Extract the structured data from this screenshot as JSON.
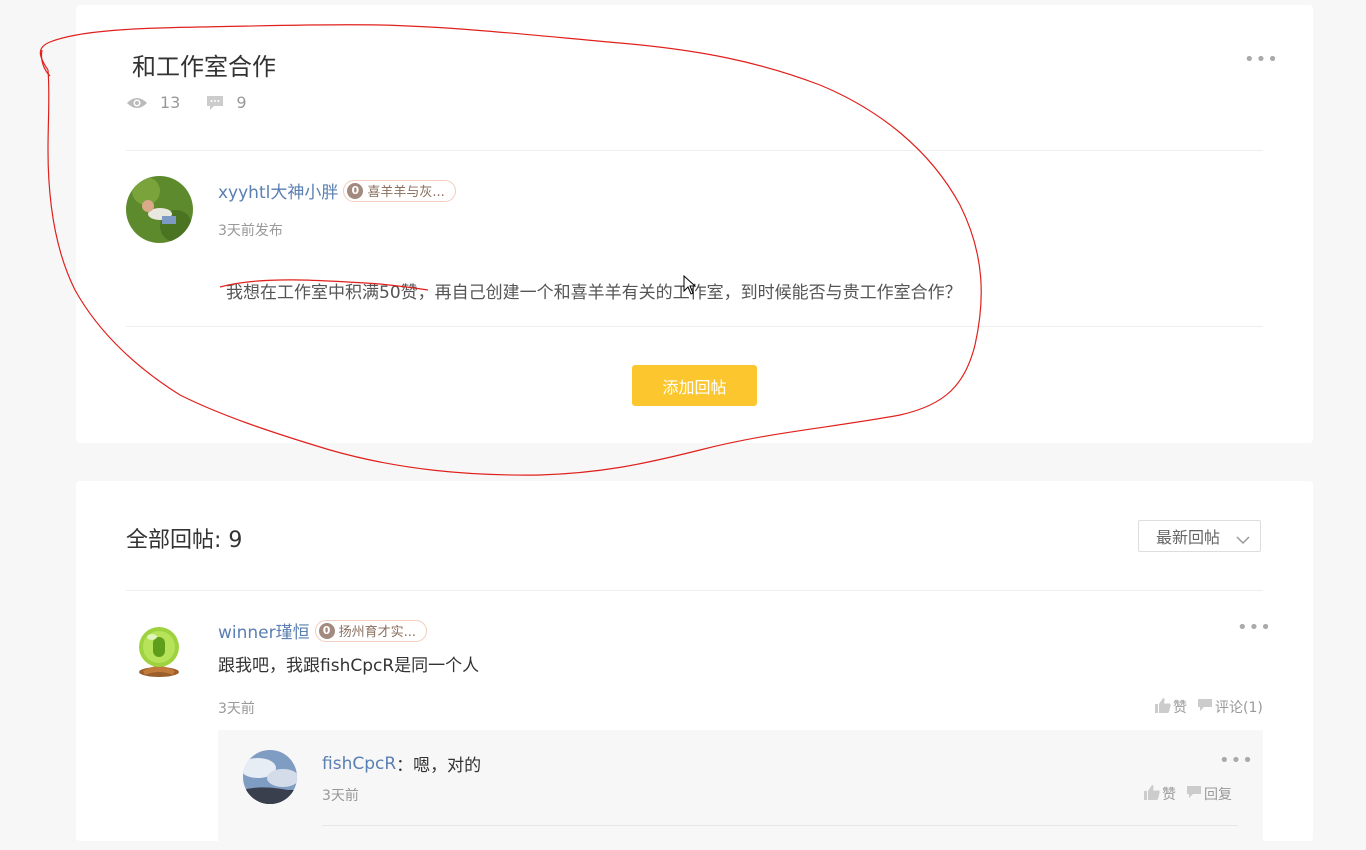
{
  "post": {
    "title": "和工作室合作",
    "views": "13",
    "comments": "9",
    "author": {
      "name": "xyyhtl大神小胖",
      "badge_num": "0",
      "badge_text": "喜羊羊与灰..."
    },
    "time": "3天前发布",
    "body": "我想在工作室中积满50赞，再自己创建一个和喜羊羊有关的工作室，到时候能否与贵工作室合作？",
    "add_reply_label": "添加回帖"
  },
  "replies": {
    "header": "全部回帖: 9",
    "sort_label": "最新回帖",
    "items": [
      {
        "author": "winner瑾恒",
        "badge_num": "0",
        "badge_text": "扬州育才实...",
        "text": "跟我吧，我跟fishCpcR是同一个人",
        "time": "3天前",
        "like_label": "赞",
        "comment_label": "评论(1)",
        "sub_replies": [
          {
            "author": "fishCpcR",
            "text": "：嗯，对的",
            "time": "3天前",
            "like_label": "赞",
            "reply_label": "回复"
          }
        ]
      }
    ]
  },
  "icons": {
    "more": "more-icon",
    "eye": "eye-icon",
    "comment": "comment-icon",
    "thumb": "thumbs-up-icon",
    "chevron": "chevron-down-icon"
  },
  "colors": {
    "accent": "#fcc72e",
    "link": "#5a7fb2",
    "annotation": "#e0201c"
  }
}
